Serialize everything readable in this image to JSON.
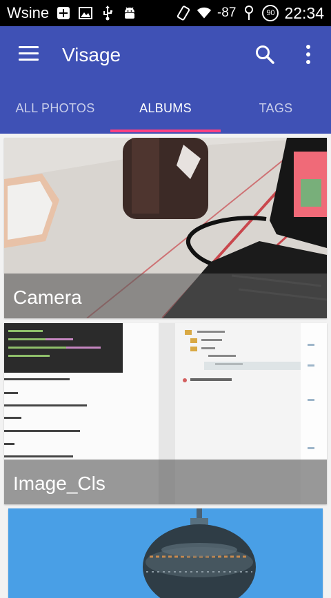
{
  "status_bar": {
    "carrier": "Wsine",
    "signal": "-87",
    "battery": "90",
    "time": "22:34"
  },
  "app_bar": {
    "title": "Visage",
    "menu_icon": "hamburger-menu-icon",
    "search_icon": "search-icon",
    "more_icon": "more-vert-icon",
    "background": "#3f51b5"
  },
  "tabs": [
    {
      "label": "ALL PHOTOS",
      "active": false
    },
    {
      "label": "ALBUMS",
      "active": true
    },
    {
      "label": "TAGS",
      "active": false
    }
  ],
  "accent_color": "#ff4081",
  "albums": [
    {
      "name": "Camera"
    },
    {
      "name": "Image_Cls"
    },
    {
      "name": ""
    }
  ]
}
